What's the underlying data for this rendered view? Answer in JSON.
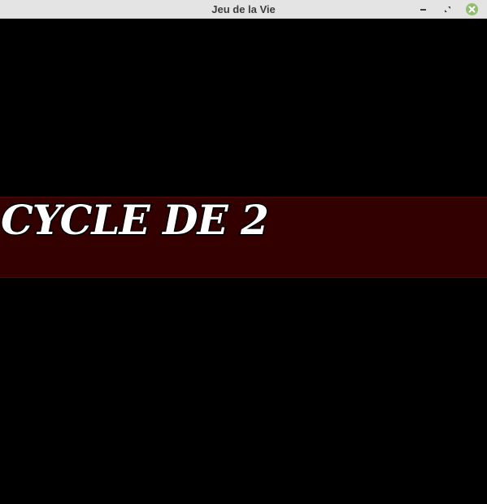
{
  "window": {
    "title": "Jeu de la Vie",
    "controls": {
      "minimize_icon": "minimize-icon",
      "maximize_icon": "maximize-icon",
      "close_icon": "close-icon",
      "close_color": "#8fbf6a"
    }
  },
  "game": {
    "background_color": "#000000",
    "banner": {
      "text": "CYCLE DE 2",
      "background_color": "#330000",
      "text_color": "#ffffff"
    }
  }
}
